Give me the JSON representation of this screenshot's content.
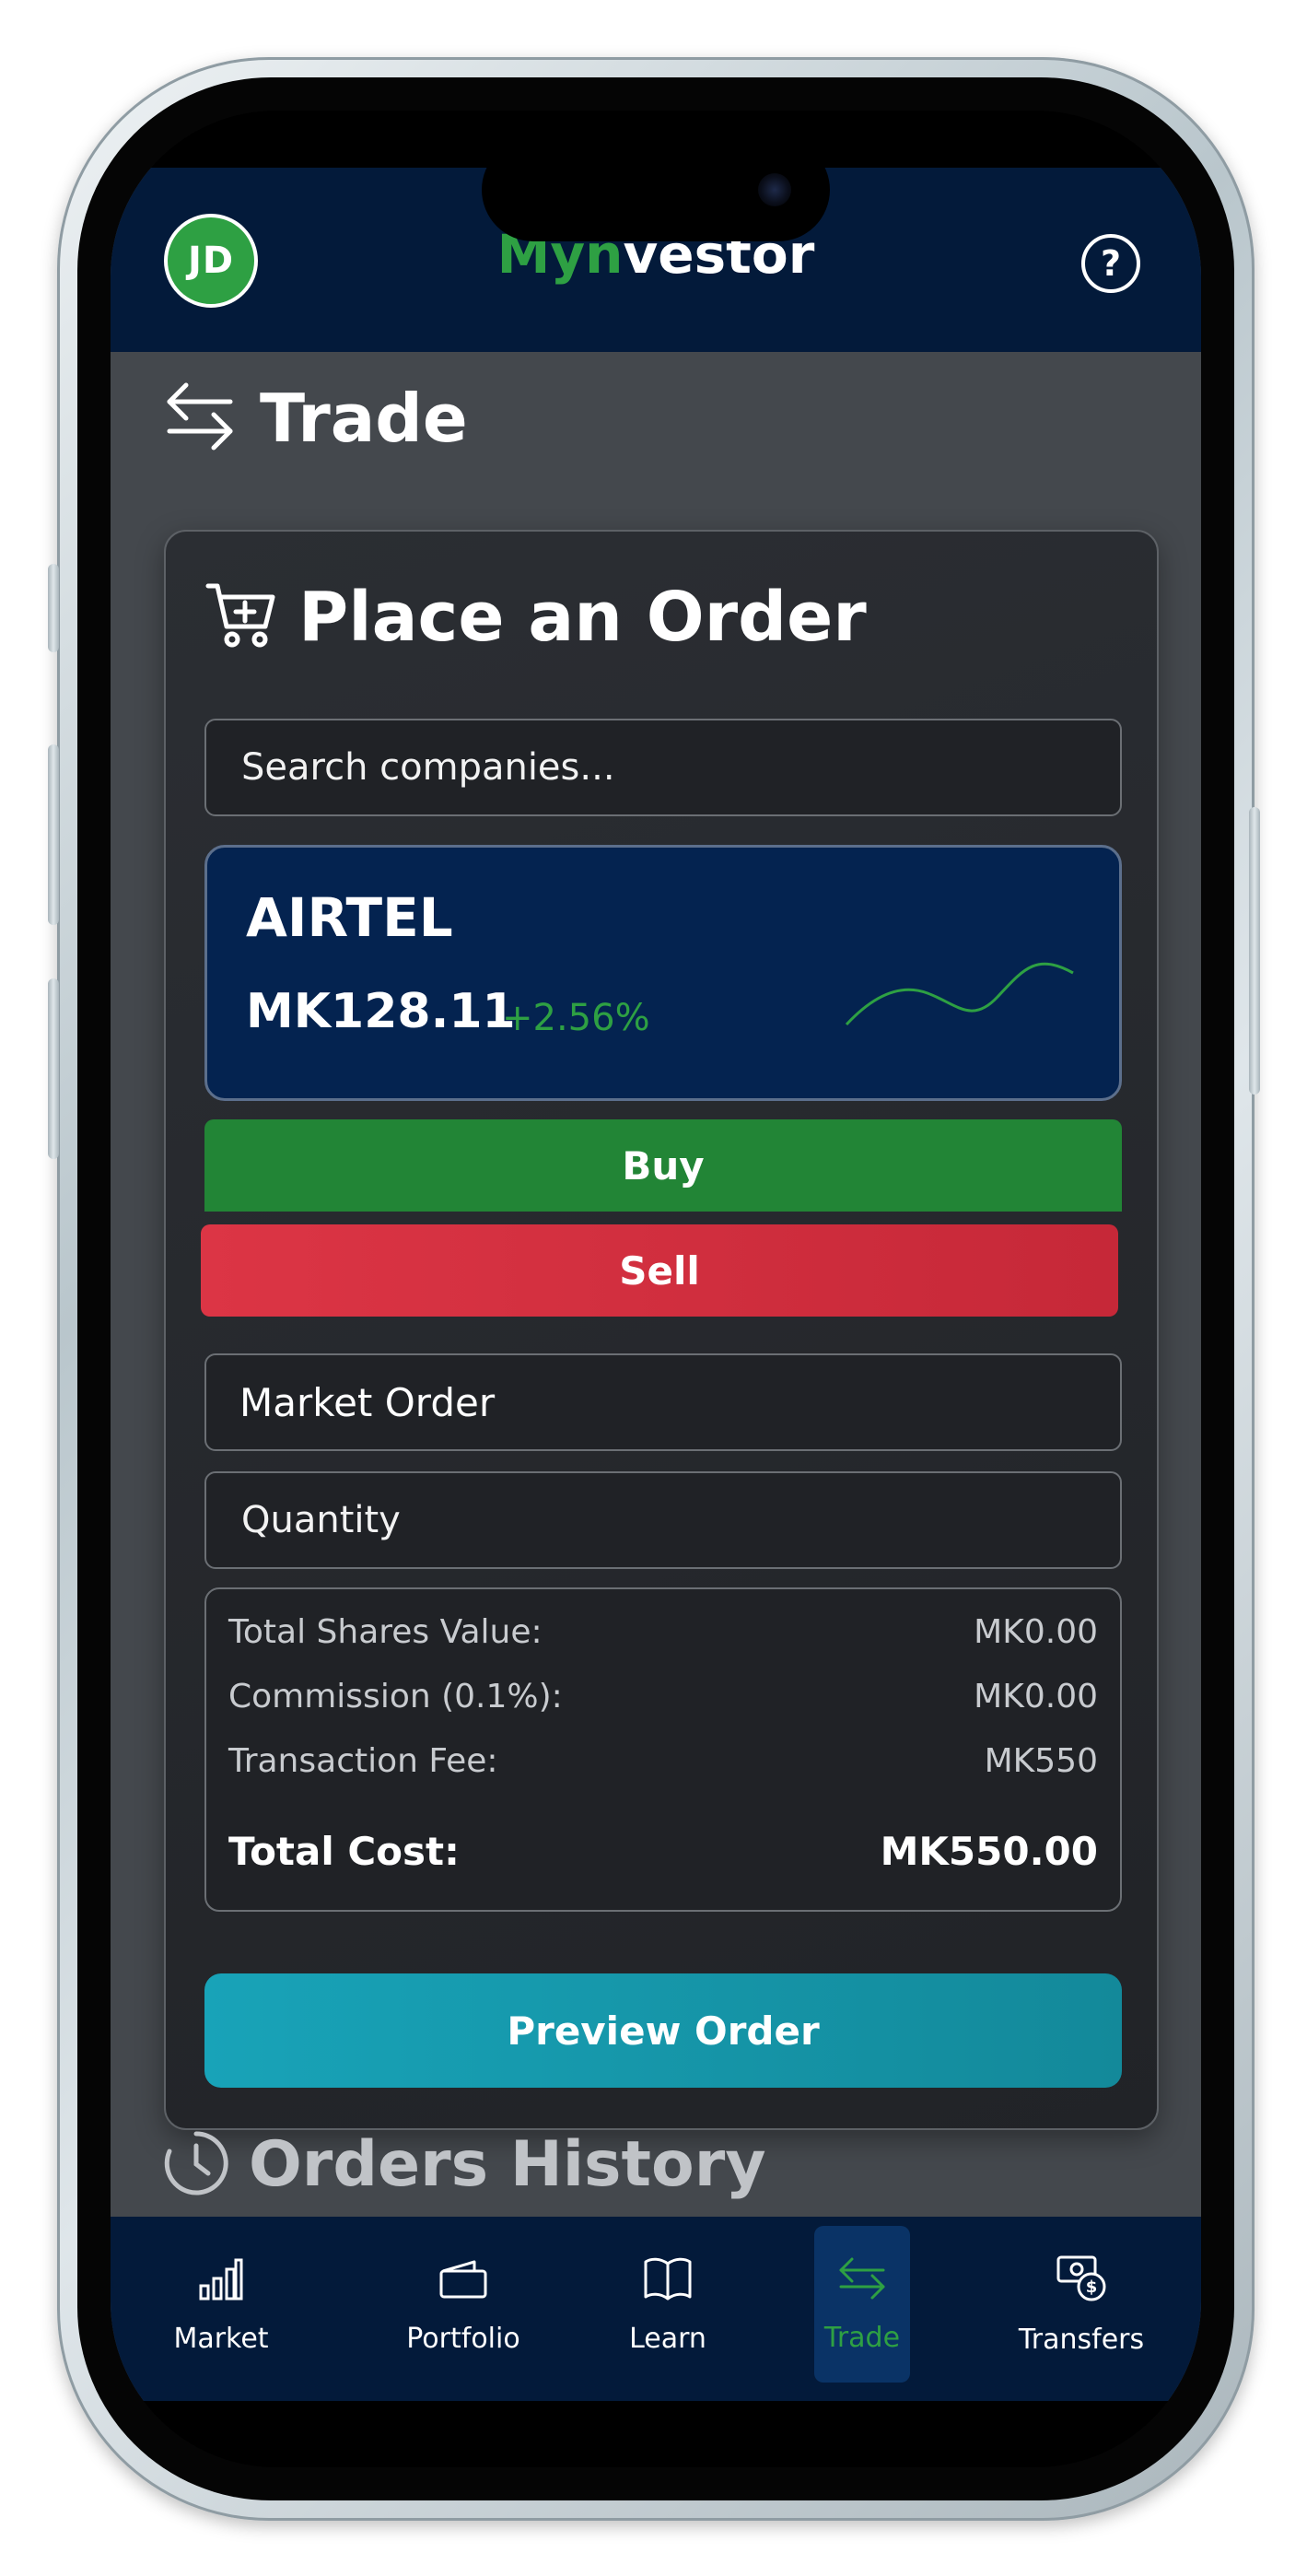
{
  "header": {
    "avatar_initials": "JD",
    "brand_part1": "Myn",
    "brand_part2": "vestor",
    "help_icon": "question-circle-icon",
    "colors": {
      "bar": "#031a3a",
      "brand_green": "#2ea043"
    }
  },
  "page": {
    "title": "Trade",
    "icon": "arrows-left-right-icon"
  },
  "order_card": {
    "title": "Place an Order",
    "icon": "cart-plus-icon",
    "search": {
      "placeholder": "Search companies..."
    },
    "stock": {
      "name": "AIRTEL",
      "price": "MK128.11",
      "change": "+2.56%",
      "change_color": "#2ea043"
    },
    "buy_label": "Buy",
    "sell_label": "Sell",
    "order_type": "Market Order",
    "quantity": {
      "placeholder": "Quantity"
    },
    "summary": {
      "rows": [
        {
          "label": "Total Shares Value:",
          "value": "MK0.00"
        },
        {
          "label": "Commission (0.1%):",
          "value": "MK0.00"
        },
        {
          "label": "Transaction Fee:",
          "value": "MK550"
        }
      ],
      "total_label": "Total Cost:",
      "total_value": "MK550.00"
    },
    "preview_label": "Preview Order"
  },
  "history": {
    "title": "Orders History",
    "icon": "clock-icon"
  },
  "bottom_nav": {
    "items": [
      {
        "label": "Market",
        "icon": "bar-chart-icon"
      },
      {
        "label": "Portfolio",
        "icon": "wallet-icon"
      },
      {
        "label": "Learn",
        "icon": "book-icon"
      },
      {
        "label": "Trade",
        "icon": "arrows-left-right-icon",
        "active": true
      },
      {
        "label": "Transfers",
        "icon": "cash-transfer-icon"
      }
    ]
  }
}
